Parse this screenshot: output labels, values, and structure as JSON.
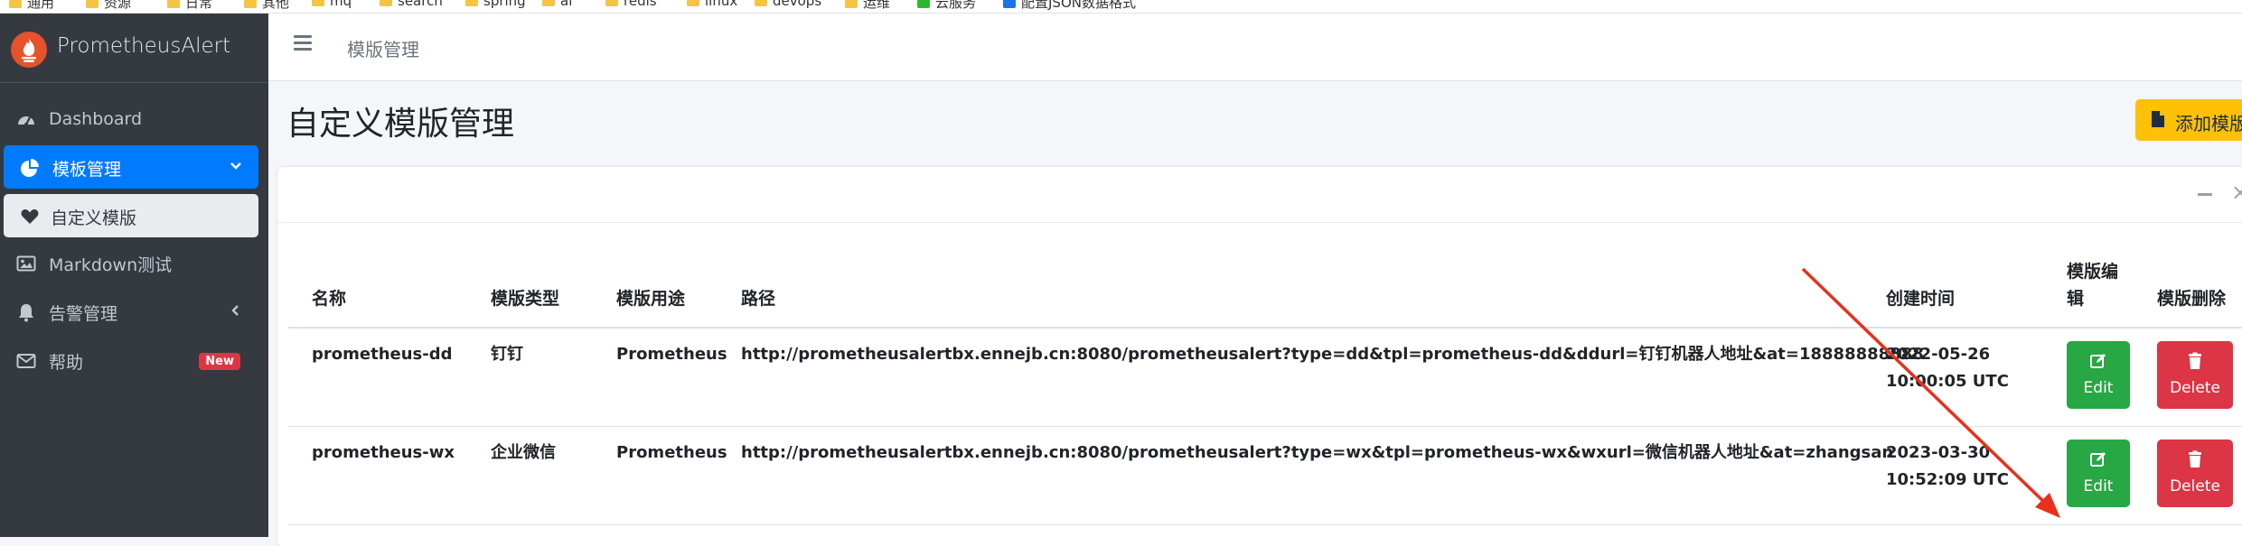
{
  "bookmarks": [
    "通用",
    "资源",
    "日常",
    "其他",
    "mq",
    "search",
    "spring",
    "ai",
    "redis",
    "linux",
    "devops",
    "运维",
    "云服务",
    "配置JSON数据格式"
  ],
  "brand": {
    "title": "PrometheusAlert"
  },
  "sidebar": {
    "items": [
      {
        "label": "Dashboard",
        "icon": "tachometer-icon"
      },
      {
        "label": "模板管理",
        "icon": "chart-pie-icon",
        "caret": "chevron-down-icon"
      },
      {
        "label": "自定义模版",
        "icon": "heart-icon"
      },
      {
        "label": "Markdown测试",
        "icon": "image-icon"
      },
      {
        "label": "告警管理",
        "icon": "bell-icon",
        "caret": "chevron-left-icon"
      },
      {
        "label": "帮助",
        "icon": "envelope-icon",
        "badge": "New"
      }
    ]
  },
  "topnav": {
    "breadcrumb": "模版管理"
  },
  "page": {
    "title": "自定义模版管理",
    "add_button": "添加模版"
  },
  "table": {
    "headers": {
      "name": "名称",
      "type": "模版类型",
      "usage": "模版用途",
      "path": "路径",
      "created": "创建时间",
      "edit_col_1": "模版编",
      "edit_col_2": "辑",
      "delete_col": "模版删除"
    },
    "rows": [
      {
        "name": "prometheus-dd",
        "type": "钉钉",
        "usage": "Prometheus",
        "path": "http://prometheusalertbx.ennejb.cn:8080/prometheusalert?type=dd&tpl=prometheus-dd&ddurl=钉钉机器人地址&at=18888888888",
        "date": "2022-05-26",
        "time": "10:00:05 UTC",
        "edit": "Edit",
        "delete": "Delete"
      },
      {
        "name": "prometheus-wx",
        "type": "企业微信",
        "usage": "Prometheus",
        "path": "http://prometheusalertbx.ennejb.cn:8080/prometheusalert?type=wx&tpl=prometheus-wx&wxurl=微信机器人地址&at=zhangsan",
        "date": "2023-03-30",
        "time": "10:52:09 UTC",
        "edit": "Edit",
        "delete": "Delete"
      }
    ]
  },
  "colors": {
    "sidebar_bg": "#343a40",
    "active_blue": "#007bff",
    "warning_yellow": "#ffc107",
    "success_green": "#28a745",
    "danger_red": "#dc3545",
    "annotation_arrow": "#e8301c"
  }
}
